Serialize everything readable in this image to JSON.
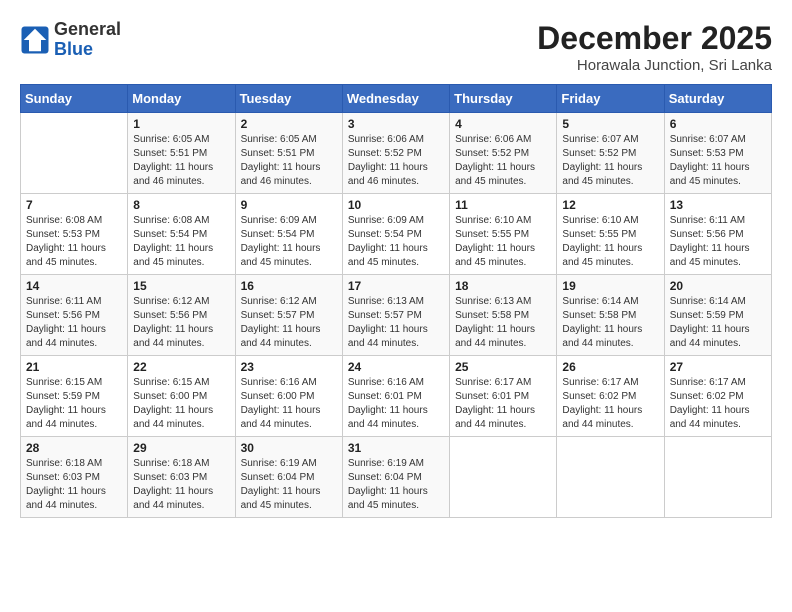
{
  "logo": {
    "general": "General",
    "blue": "Blue"
  },
  "title": {
    "month": "December 2025",
    "location": "Horawala Junction, Sri Lanka"
  },
  "header_days": [
    "Sunday",
    "Monday",
    "Tuesday",
    "Wednesday",
    "Thursday",
    "Friday",
    "Saturday"
  ],
  "weeks": [
    [
      {
        "day": "",
        "info": ""
      },
      {
        "day": "1",
        "info": "Sunrise: 6:05 AM\nSunset: 5:51 PM\nDaylight: 11 hours and 46 minutes."
      },
      {
        "day": "2",
        "info": "Sunrise: 6:05 AM\nSunset: 5:51 PM\nDaylight: 11 hours and 46 minutes."
      },
      {
        "day": "3",
        "info": "Sunrise: 6:06 AM\nSunset: 5:52 PM\nDaylight: 11 hours and 46 minutes."
      },
      {
        "day": "4",
        "info": "Sunrise: 6:06 AM\nSunset: 5:52 PM\nDaylight: 11 hours and 45 minutes."
      },
      {
        "day": "5",
        "info": "Sunrise: 6:07 AM\nSunset: 5:52 PM\nDaylight: 11 hours and 45 minutes."
      },
      {
        "day": "6",
        "info": "Sunrise: 6:07 AM\nSunset: 5:53 PM\nDaylight: 11 hours and 45 minutes."
      }
    ],
    [
      {
        "day": "7",
        "info": "Sunrise: 6:08 AM\nSunset: 5:53 PM\nDaylight: 11 hours and 45 minutes."
      },
      {
        "day": "8",
        "info": "Sunrise: 6:08 AM\nSunset: 5:54 PM\nDaylight: 11 hours and 45 minutes."
      },
      {
        "day": "9",
        "info": "Sunrise: 6:09 AM\nSunset: 5:54 PM\nDaylight: 11 hours and 45 minutes."
      },
      {
        "day": "10",
        "info": "Sunrise: 6:09 AM\nSunset: 5:54 PM\nDaylight: 11 hours and 45 minutes."
      },
      {
        "day": "11",
        "info": "Sunrise: 6:10 AM\nSunset: 5:55 PM\nDaylight: 11 hours and 45 minutes."
      },
      {
        "day": "12",
        "info": "Sunrise: 6:10 AM\nSunset: 5:55 PM\nDaylight: 11 hours and 45 minutes."
      },
      {
        "day": "13",
        "info": "Sunrise: 6:11 AM\nSunset: 5:56 PM\nDaylight: 11 hours and 45 minutes."
      }
    ],
    [
      {
        "day": "14",
        "info": "Sunrise: 6:11 AM\nSunset: 5:56 PM\nDaylight: 11 hours and 44 minutes."
      },
      {
        "day": "15",
        "info": "Sunrise: 6:12 AM\nSunset: 5:56 PM\nDaylight: 11 hours and 44 minutes."
      },
      {
        "day": "16",
        "info": "Sunrise: 6:12 AM\nSunset: 5:57 PM\nDaylight: 11 hours and 44 minutes."
      },
      {
        "day": "17",
        "info": "Sunrise: 6:13 AM\nSunset: 5:57 PM\nDaylight: 11 hours and 44 minutes."
      },
      {
        "day": "18",
        "info": "Sunrise: 6:13 AM\nSunset: 5:58 PM\nDaylight: 11 hours and 44 minutes."
      },
      {
        "day": "19",
        "info": "Sunrise: 6:14 AM\nSunset: 5:58 PM\nDaylight: 11 hours and 44 minutes."
      },
      {
        "day": "20",
        "info": "Sunrise: 6:14 AM\nSunset: 5:59 PM\nDaylight: 11 hours and 44 minutes."
      }
    ],
    [
      {
        "day": "21",
        "info": "Sunrise: 6:15 AM\nSunset: 5:59 PM\nDaylight: 11 hours and 44 minutes."
      },
      {
        "day": "22",
        "info": "Sunrise: 6:15 AM\nSunset: 6:00 PM\nDaylight: 11 hours and 44 minutes."
      },
      {
        "day": "23",
        "info": "Sunrise: 6:16 AM\nSunset: 6:00 PM\nDaylight: 11 hours and 44 minutes."
      },
      {
        "day": "24",
        "info": "Sunrise: 6:16 AM\nSunset: 6:01 PM\nDaylight: 11 hours and 44 minutes."
      },
      {
        "day": "25",
        "info": "Sunrise: 6:17 AM\nSunset: 6:01 PM\nDaylight: 11 hours and 44 minutes."
      },
      {
        "day": "26",
        "info": "Sunrise: 6:17 AM\nSunset: 6:02 PM\nDaylight: 11 hours and 44 minutes."
      },
      {
        "day": "27",
        "info": "Sunrise: 6:17 AM\nSunset: 6:02 PM\nDaylight: 11 hours and 44 minutes."
      }
    ],
    [
      {
        "day": "28",
        "info": "Sunrise: 6:18 AM\nSunset: 6:03 PM\nDaylight: 11 hours and 44 minutes."
      },
      {
        "day": "29",
        "info": "Sunrise: 6:18 AM\nSunset: 6:03 PM\nDaylight: 11 hours and 44 minutes."
      },
      {
        "day": "30",
        "info": "Sunrise: 6:19 AM\nSunset: 6:04 PM\nDaylight: 11 hours and 45 minutes."
      },
      {
        "day": "31",
        "info": "Sunrise: 6:19 AM\nSunset: 6:04 PM\nDaylight: 11 hours and 45 minutes."
      },
      {
        "day": "",
        "info": ""
      },
      {
        "day": "",
        "info": ""
      },
      {
        "day": "",
        "info": ""
      }
    ]
  ]
}
